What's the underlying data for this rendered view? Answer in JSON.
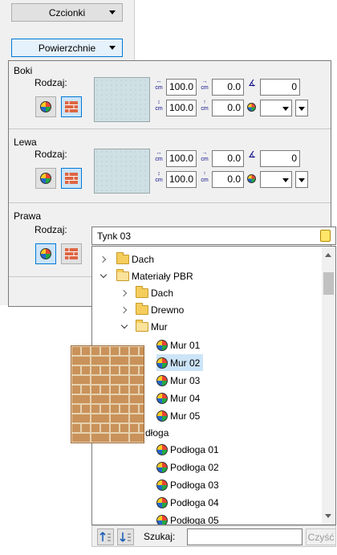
{
  "top_buttons": [
    {
      "label": "Czcionki"
    },
    {
      "label": "Powierzchnie"
    }
  ],
  "sections": {
    "boki": {
      "title": "Boki",
      "rodzaj_label": "Rodzaj:",
      "width": "100.0",
      "offset_x": "0.0",
      "angle": "0",
      "height": "100.0",
      "offset_y": "0.0"
    },
    "lewa": {
      "title": "Lewa",
      "rodzaj_label": "Rodzaj:",
      "width": "100.0",
      "offset_x": "0.0",
      "angle": "0",
      "height": "100.0",
      "offset_y": "0.0"
    },
    "prawa": {
      "title": "Prawa",
      "rodzaj_label": "Rodzaj:",
      "selected_material": "Tynk 03"
    }
  },
  "tree": [
    {
      "label": "Dach",
      "type": "folder",
      "expanded": false
    },
    {
      "label": "Materiały PBR",
      "type": "folder",
      "expanded": true
    },
    {
      "label": "Dach",
      "type": "folder",
      "expanded": false
    },
    {
      "label": "Drewno",
      "type": "folder",
      "expanded": false
    },
    {
      "label": "Mur",
      "type": "folder",
      "expanded": true
    },
    {
      "label": "Mur 01",
      "type": "material"
    },
    {
      "label": "Mur 02",
      "type": "material",
      "selected": true
    },
    {
      "label": "Mur 03",
      "type": "material"
    },
    {
      "label": "Mur 04",
      "type": "material"
    },
    {
      "label": "Mur 05",
      "type": "material"
    },
    {
      "label": "dłoga",
      "type": "folder-partial"
    },
    {
      "label": "Podłoga 01",
      "type": "material"
    },
    {
      "label": "Podłoga 02",
      "type": "material"
    },
    {
      "label": "Podłoga 03",
      "type": "material"
    },
    {
      "label": "Podłoga 04",
      "type": "material"
    },
    {
      "label": "Podłoga 05",
      "type": "material"
    }
  ],
  "bottom": {
    "search_label": "Szukaj:",
    "search_value": "",
    "clear_label": "Czyść"
  },
  "colors": {
    "accent": "#0078d7",
    "selection": "#cce4f7",
    "panel_bg": "#f0f0f0"
  }
}
